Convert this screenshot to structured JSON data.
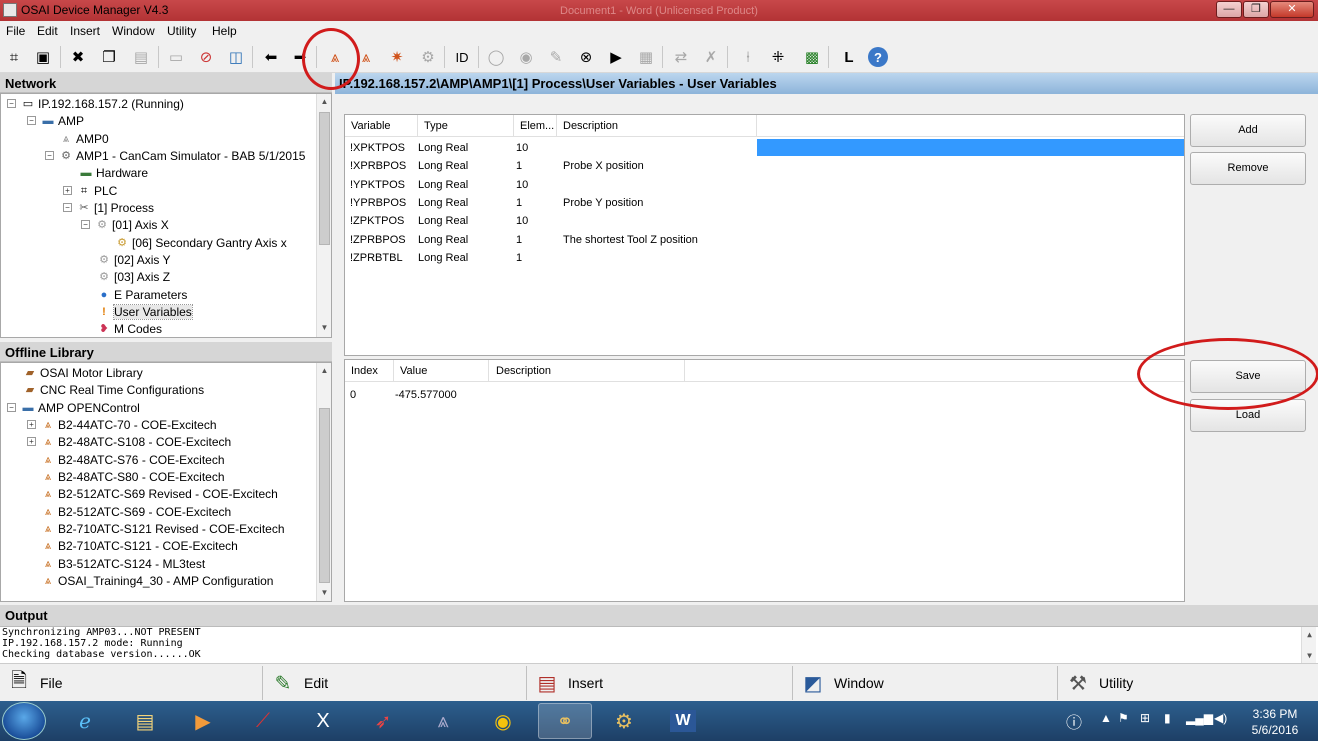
{
  "window": {
    "title": "OSAI Device Manager  V4.3",
    "faded_title": "Document1 - Word (Unlicensed Product)",
    "minimize": "—",
    "restore": "❐",
    "close": "✕"
  },
  "menu": [
    "File",
    "Edit",
    "Insert",
    "Window",
    "Utility",
    "Help"
  ],
  "toolbar": {
    "id_label": "ID",
    "l_label": "L",
    "help_label": "?"
  },
  "network": {
    "header": "Network",
    "items": [
      {
        "label": "IP.192.168.157.2 (Running)",
        "icon": "computer-icon"
      },
      {
        "label": "AMP",
        "icon": "folder-icon"
      },
      {
        "label": "AMP0",
        "icon": "amp-icon"
      },
      {
        "label": "AMP1 - CanCam Simulator - BAB 5/1/2015",
        "icon": "gear-cube-icon"
      },
      {
        "label": "Hardware",
        "icon": "board-icon"
      },
      {
        "label": "PLC",
        "icon": "grid-icon"
      },
      {
        "label": "[1] Process",
        "icon": "process-icon"
      },
      {
        "label": "[01] Axis X",
        "icon": "gear-icon"
      },
      {
        "label": "[06] Secondary Gantry Axis x",
        "icon": "gear-icon"
      },
      {
        "label": "[02] Axis Y",
        "icon": "gear-icon"
      },
      {
        "label": "[03] Axis Z",
        "icon": "gear-icon"
      },
      {
        "label": "E Parameters",
        "icon": "sphere-icon"
      },
      {
        "label": "User Variables",
        "icon": "exclamation-icon"
      },
      {
        "label": "M Codes",
        "icon": "code-icon"
      }
    ]
  },
  "library": {
    "header": "Offline Library",
    "items": [
      {
        "label": "OSAI Motor Library"
      },
      {
        "label": "CNC Real Time Configurations"
      },
      {
        "label": "AMP OPENControl"
      },
      {
        "label": "B2-44ATC-70 - COE-Excitech"
      },
      {
        "label": "B2-48ATC-S108 - COE-Excitech"
      },
      {
        "label": "B2-48ATC-S76 - COE-Excitech"
      },
      {
        "label": "B2-48ATC-S80 - COE-Excitech"
      },
      {
        "label": "B2-512ATC-S69 Revised - COE-Excitech"
      },
      {
        "label": "B2-512ATC-S69 - COE-Excitech"
      },
      {
        "label": "B2-710ATC-S121 Revised - COE-Excitech"
      },
      {
        "label": "B2-710ATC-S121 - COE-Excitech"
      },
      {
        "label": "B3-512ATC-S124 - ML3test"
      },
      {
        "label": "OSAI_Training4_30 - AMP Configuration"
      }
    ]
  },
  "main": {
    "path": "IP.192.168.157.2\\AMP\\AMP1\\[1] Process\\User Variables - User Variables",
    "variables": {
      "columns": [
        "Variable",
        "Type",
        "Elem...",
        "Description"
      ],
      "rows": [
        [
          "!XPKTPOS",
          "Long Real",
          "10",
          ""
        ],
        [
          "!XPRBPOS",
          "Long Real",
          "1",
          "Probe X position"
        ],
        [
          "!YPKTPOS",
          "Long Real",
          "10",
          ""
        ],
        [
          "!YPRBPOS",
          "Long Real",
          "1",
          "Probe Y position"
        ],
        [
          "!ZPKTPOS",
          "Long Real",
          "10",
          ""
        ],
        [
          "!ZPRBPOS",
          "Long Real",
          "1",
          "The shortest Tool Z position"
        ],
        [
          "!ZPRBTBL",
          "Long Real",
          "1",
          ""
        ]
      ]
    },
    "values": {
      "columns": [
        "Index",
        "Value",
        "Description"
      ],
      "rows": [
        [
          "0",
          "-475.577000",
          ""
        ]
      ]
    },
    "buttons": {
      "add": "Add",
      "remove": "Remove",
      "save": "Save",
      "load": "Load"
    }
  },
  "output": {
    "header": "Output",
    "lines": [
      "Synchronizing AMP03...NOT PRESENT",
      "IP.192.168.157.2 mode: Running",
      "Checking database version......OK"
    ]
  },
  "bottombar": [
    "File",
    "Edit",
    "Insert",
    "Window",
    "Utility"
  ],
  "taskbar": {
    "time": "3:36 PM",
    "date": "5/6/2016",
    "apps": [
      "ie-icon",
      "explorer-icon",
      "media-icon",
      "app-red-icon",
      "x-tool-icon",
      "rocket-icon",
      "amp-app-icon",
      "chrome-icon",
      "link-icon",
      "gears-icon",
      "word-icon"
    ]
  },
  "colors": {
    "title_bar": "#b33335",
    "path_header": "#8db4da",
    "selection": "#3399ff",
    "annotation_circle": "#d11b1b"
  }
}
